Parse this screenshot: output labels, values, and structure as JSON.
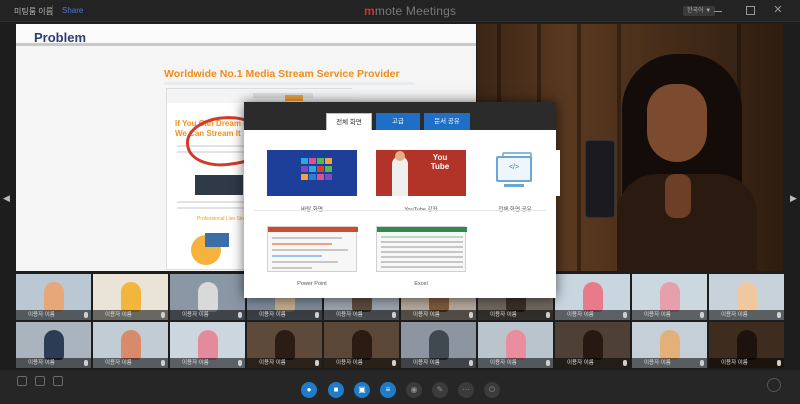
{
  "window": {
    "meeting_name": "미팅룸 이름",
    "share_link": "Share",
    "brand_mark": "m",
    "brand_name": "mote Meetings",
    "lang_toggle": "한국어 ▼"
  },
  "presentation": {
    "slide_title": "Problem",
    "web_headline": "Worldwide No.1 Media Stream Service Provider",
    "hero_text_line1": "If You Can Dream It,",
    "hero_text_line2": "We Can Stream It",
    "sub_text": "Professional Live Streaming"
  },
  "dialog": {
    "tabs": [
      {
        "label": "전체 화면",
        "active": true
      },
      {
        "label": "고급",
        "active": false
      },
      {
        "label": "문서 공유",
        "active": false
      }
    ],
    "options": [
      {
        "label": "바탕 화면",
        "icon": "desktop-screen-icon"
      },
      {
        "label": "YouTube 강좌",
        "icon": "youtube-icon"
      },
      {
        "label": "전체 화면 공유",
        "icon": "screen-share-icon"
      },
      {
        "label": "Power Point",
        "icon": "powerpoint-icon"
      },
      {
        "label": "Excel",
        "icon": "excel-icon"
      }
    ],
    "youtube_logo_line1": "You",
    "youtube_logo_line2": "Tube",
    "code_glyph": "</>"
  },
  "participants": {
    "row1": [
      "이용자 이름",
      "이용자 이름",
      "이용자 이름",
      "이용자 이름",
      "이용자 이름",
      "이용자 이름",
      "이용자 이름",
      "이용자 이름",
      "이용자 이름",
      "이용자 이름"
    ],
    "row2": [
      "이용자 이름",
      "이용자 이름",
      "이용자 이름",
      "이용자 이름",
      "이용자 이름",
      "이용자 이름",
      "이용자 이름",
      "이용자 이름",
      "이용자 이름",
      "이용자 이름"
    ]
  },
  "colors": {
    "accent_blue": "#1f6fc6",
    "brand_red": "#c0392b",
    "web_orange": "#f28c17"
  }
}
